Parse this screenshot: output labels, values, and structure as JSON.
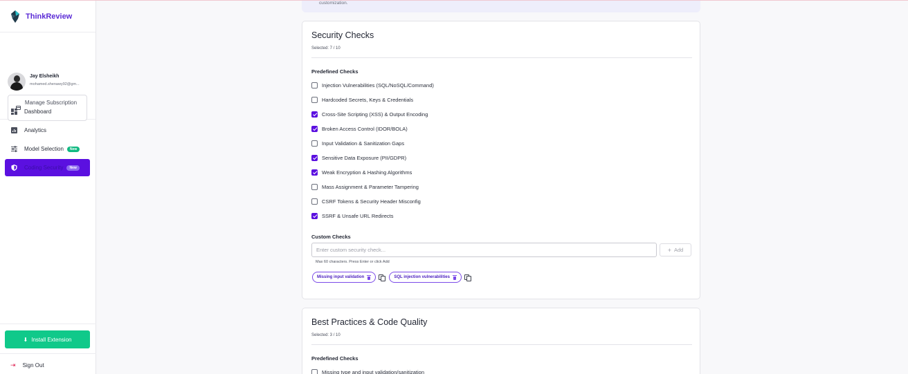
{
  "brand": {
    "name": "ThinkReview"
  },
  "user": {
    "name": "Jay Elsheikh",
    "email": "mohamed.shenawy92@gm..."
  },
  "manage_button": {
    "label": "Manage Subscription"
  },
  "nav": [
    {
      "label": "Dashboard",
      "icon": "dashboard-icon",
      "badge": ""
    },
    {
      "label": "Analytics",
      "icon": "analytics-icon",
      "badge": ""
    },
    {
      "label": "Model Selection",
      "icon": "sliders-icon",
      "badge": "New"
    },
    {
      "label": "Coding Security",
      "icon": "shield-icon",
      "badge": "New",
      "active": true
    }
  ],
  "install_button": {
    "label": "Install Extension"
  },
  "signout": {
    "label": "Sign Out"
  },
  "banner": {
    "text": "customization."
  },
  "security_card": {
    "title": "Security Checks",
    "selected": "Selected: 7 / 10",
    "predefined_label": "Predefined Checks",
    "checks": [
      {
        "label": "Injection Vulnerabilities (SQL/NoSQL/Command)",
        "checked": false
      },
      {
        "label": "Hardcoded Secrets, Keys & Credentials",
        "checked": false
      },
      {
        "label": "Cross-Site Scripting (XSS) & Output Encoding",
        "checked": true
      },
      {
        "label": "Broken Access Control (IDOR/BOLA)",
        "checked": true
      },
      {
        "label": "Input Validation & Sanitization Gaps",
        "checked": false
      },
      {
        "label": "Sensitive Data Exposure (PII/GDPR)",
        "checked": true
      },
      {
        "label": "Weak Encryption & Hashing Algorithms",
        "checked": true
      },
      {
        "label": "Mass Assignment & Parameter Tampering",
        "checked": false
      },
      {
        "label": "CSRF Tokens & Security Header Misconfig",
        "checked": false
      },
      {
        "label": "SSRF & Unsafe URL Redirects",
        "checked": true
      }
    ],
    "custom_label": "Custom Checks",
    "custom_placeholder": "Enter custom security check...",
    "add_label": "Add",
    "hint": "Max 60 characters. Press Enter or click Add",
    "tags": [
      "Missing input validation",
      "SQL injection vulnerabilities"
    ]
  },
  "quality_card": {
    "title": "Best Practices & Code Quality",
    "selected": "Selected: 3 / 10",
    "predefined_label": "Predefined Checks",
    "checks": [
      {
        "label": "Missing type and input validation/sanitization",
        "checked": false
      }
    ]
  },
  "colors": {
    "accent": "#5b10e0",
    "success": "#10c98a",
    "danger": "#e02d5b"
  }
}
